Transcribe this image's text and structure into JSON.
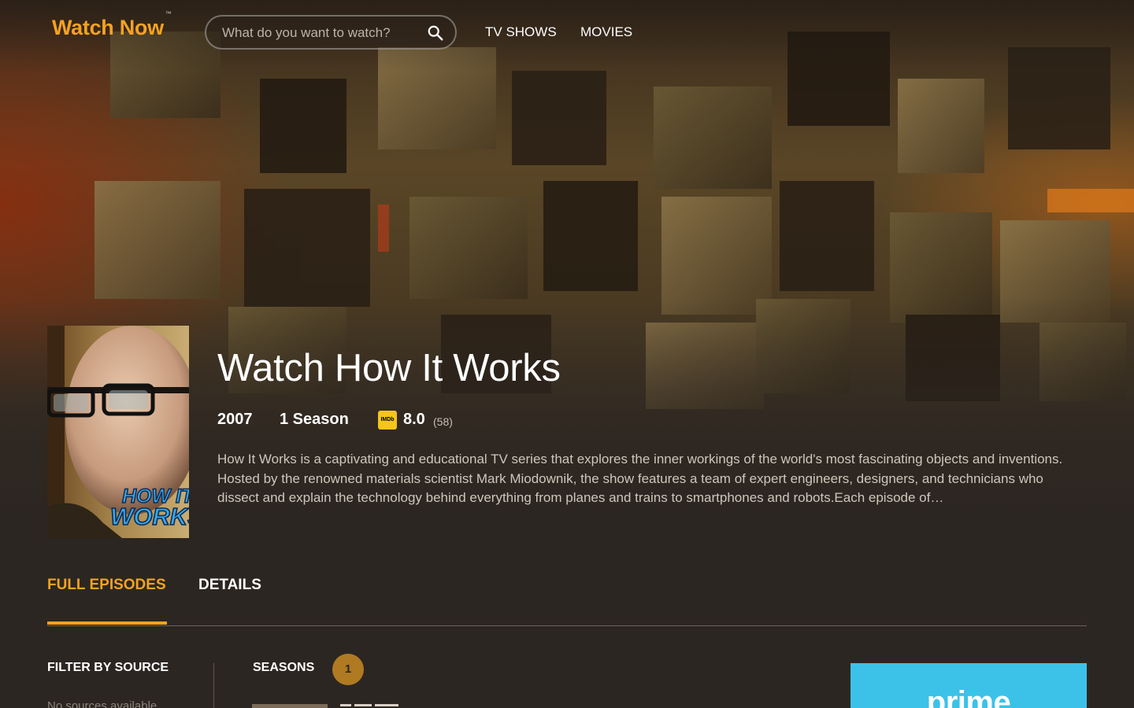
{
  "header": {
    "logo": "Watch Now",
    "logo_mark": "™",
    "search_placeholder": "What do you want to watch?",
    "nav": [
      "TV SHOWS",
      "MOVIES"
    ]
  },
  "show": {
    "title": "Watch How It Works",
    "year": "2007",
    "seasons_label": "1 Season",
    "imdb_label": "IMDb",
    "rating": "8.0",
    "votes": "(58)",
    "description": "How It Works is a captivating and educational TV series that explores the inner workings of the world's most fascinating objects and inventions. Hosted by the renowned materials scientist Mark Miodownik, the show features a team of expert engineers, designers, and technicians who dissect and explain the technology behind everything from planes and trains to smartphones and robots.Each episode of…",
    "poster_text": [
      "HOW IT",
      "WORKS"
    ]
  },
  "tabs": {
    "items": [
      "FULL EPISODES",
      "DETAILS"
    ],
    "active": "FULL EPISODES"
  },
  "filter": {
    "title": "FILTER BY SOURCE",
    "note": "No sources available"
  },
  "seasons": {
    "title": "SEASONS",
    "list": [
      "1"
    ],
    "selected": "1"
  },
  "ad": {
    "text": "prime"
  },
  "colors": {
    "accent": "#f4a321",
    "background": "#2c2622",
    "season_pill": "#b07a22",
    "imdb": "#f5c518",
    "prime_ad": "#3cc2e8"
  }
}
